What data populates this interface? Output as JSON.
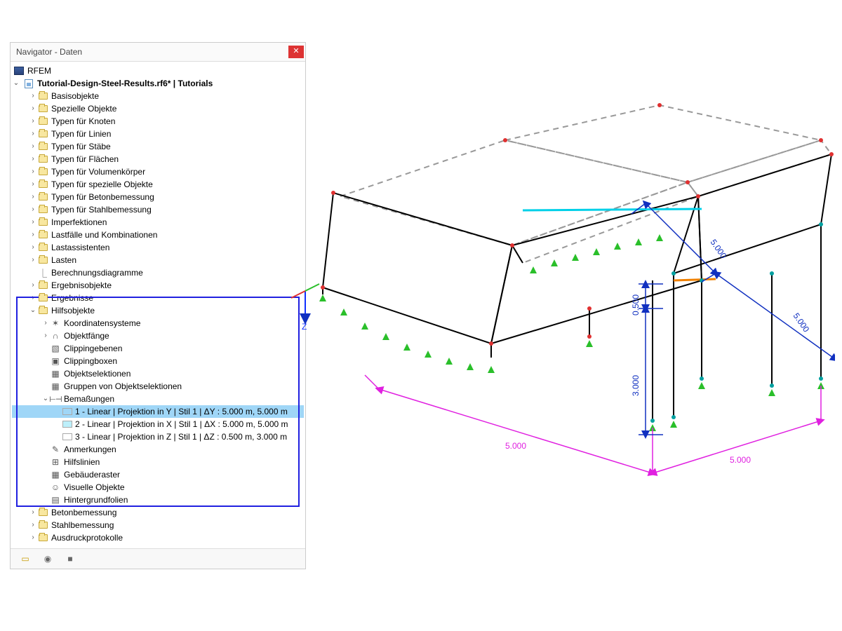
{
  "panel": {
    "title": "Navigator - Daten",
    "close_glyph": "✕"
  },
  "root": {
    "label": "RFEM"
  },
  "file": {
    "label": "Tutorial-Design-Steel-Results.rf6* | Tutorials"
  },
  "folders": {
    "basisobjekte": "Basisobjekte",
    "spezielle_objekte": "Spezielle Objekte",
    "typen_knoten": "Typen für Knoten",
    "typen_linien": "Typen für Linien",
    "typen_staebe": "Typen für Stäbe",
    "typen_flaechen": "Typen für Flächen",
    "typen_volumen": "Typen für Volumenkörper",
    "typen_spezielle": "Typen für spezielle Objekte",
    "typen_beton": "Typen für Betonbemessung",
    "typen_stahl": "Typen für Stahlbemessung",
    "imperfektionen": "Imperfektionen",
    "lastfaelle": "Lastfälle und Kombinationen",
    "lastassistenten": "Lastassistenten",
    "lasten": "Lasten",
    "berechnungsdiagramme": "Berechnungsdiagramme",
    "ergebnisobjekte": "Ergebnisobjekte",
    "ergebnisse": "Ergebnisse",
    "hilfsobjekte": "Hilfsobjekte",
    "koordinatensysteme": "Koordinatensysteme",
    "objektfaenge": "Objektfänge",
    "clippingebenen": "Clippingebenen",
    "clippingboxen": "Clippingboxen",
    "objektselektionen": "Objektselektionen",
    "gruppen_objektselektionen": "Gruppen von Objektselektionen",
    "bemassungen": "Bemaßungen",
    "bemassung1": "1 - Linear | Projektion in Y | Stil 1 | ΔY : 5.000 m, 5.000 m",
    "bemassung2": "2 - Linear | Projektion in X | Stil 1 | ΔX : 5.000 m, 5.000 m",
    "bemassung3": "3 - Linear | Projektion in Z | Stil 1 | ΔZ : 0.500 m, 3.000 m",
    "anmerkungen": "Anmerkungen",
    "hilfslinien": "Hilfslinien",
    "gebaeuderaster": "Gebäuderaster",
    "visuelle_objekte": "Visuelle Objekte",
    "hintergrundfolien": "Hintergrundfolien",
    "betonbemessung": "Betonbemessung",
    "stahlbemessung": "Stahlbemessung",
    "ausdruckprotokolle": "Ausdruckprotokolle"
  },
  "swatches": {
    "bemassung1": "#9fd6f7",
    "bemassung2": "#bdeffa",
    "bemassung3": "#ffffff"
  },
  "axes": {
    "z_label": "Z"
  },
  "dims": {
    "mag_l": "5.000",
    "mag_r": "5.000",
    "blue_top": "5.000",
    "blue_bottom_r": "5.000",
    "blue_v_top": "0.500",
    "blue_v_bottom": "3.000"
  }
}
